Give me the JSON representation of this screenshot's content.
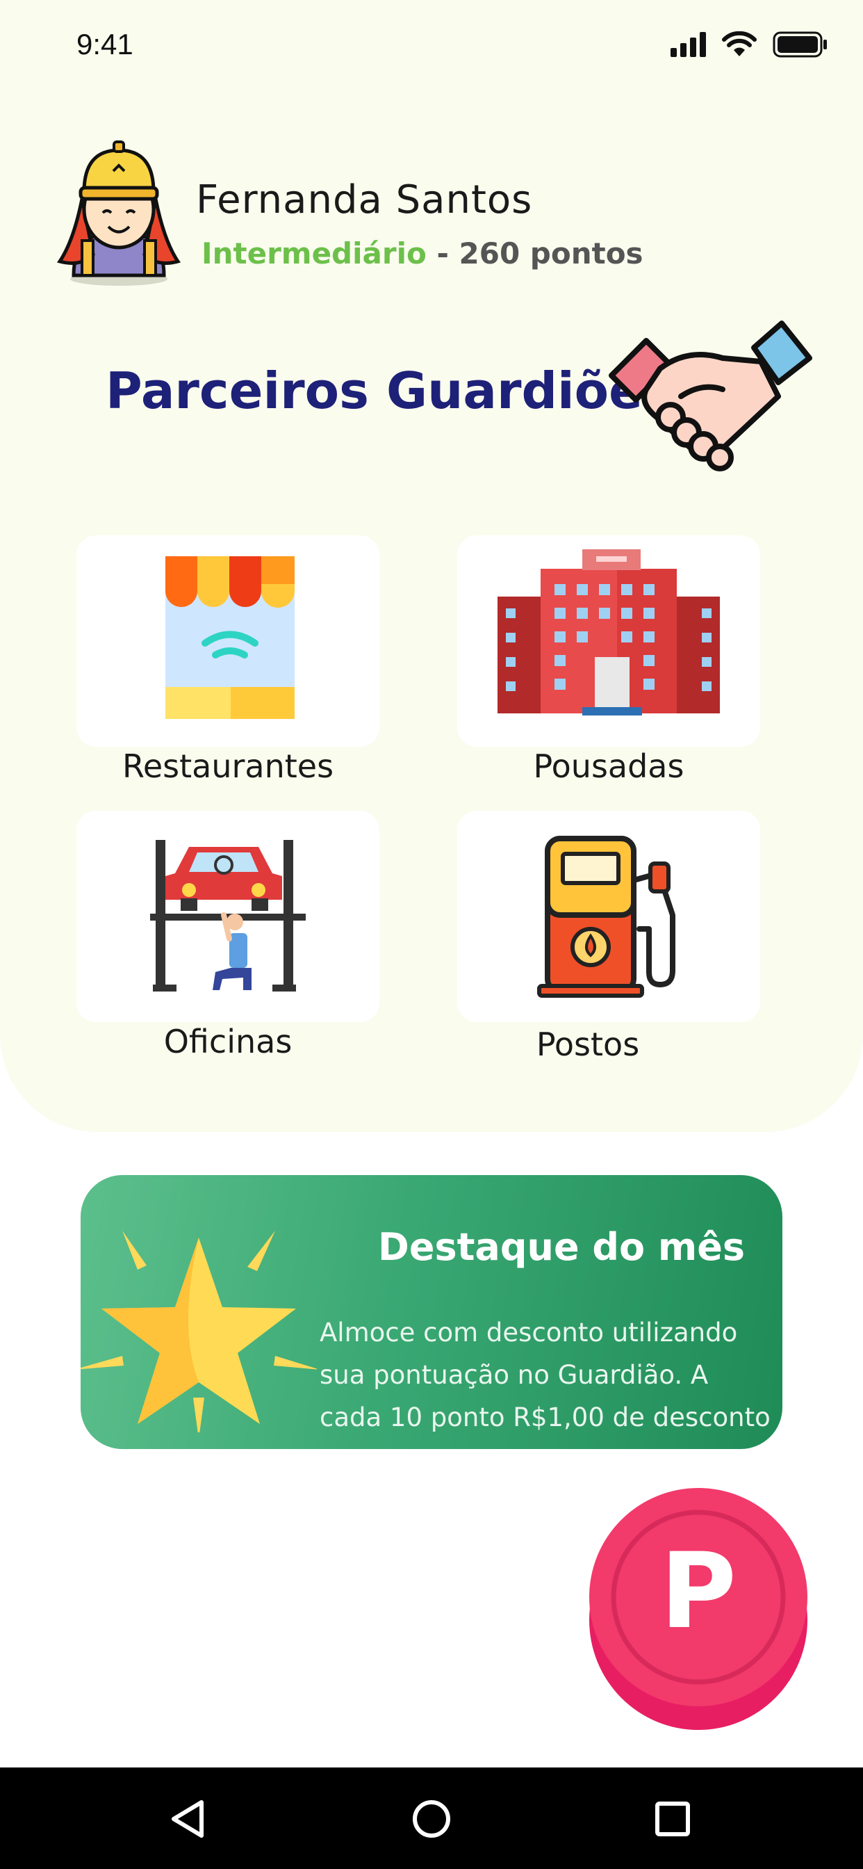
{
  "status_bar": {
    "time": "9:41",
    "icons": [
      "signal-icon",
      "wifi-icon",
      "battery-icon"
    ]
  },
  "profile": {
    "name": "Fernanda Santos",
    "level": "Intermediário",
    "points_text": " - 260 pontos",
    "avatar_icon": "avatar-explorer-icon"
  },
  "page": {
    "title": "Parceiros Guardiões",
    "title_icon": "handshake-icon"
  },
  "categories": [
    {
      "label": "Restaurantes",
      "icon": "store-wifi-icon"
    },
    {
      "label": "Pousadas",
      "icon": "hotel-building-icon"
    },
    {
      "label": "Oficinas",
      "icon": "car-lift-mechanic-icon"
    },
    {
      "label": "Postos",
      "icon": "fuel-pump-icon"
    }
  ],
  "highlight": {
    "title": "Destaque do mês",
    "lines": [
      "Almoce com desconto utilizando",
      "sua pontuação no Guardião. A",
      "cada 10 ponto R$1,00 de desconto"
    ],
    "icon": "star-icon"
  },
  "points_button": {
    "letter": "P"
  },
  "nav": {
    "buttons": [
      "back-icon",
      "home-icon",
      "recents-icon"
    ]
  },
  "colors": {
    "panel_bg": "#fafcee",
    "title_blue": "#1e2178",
    "level_green": "#6cc04a",
    "banner_green": "#3aa873",
    "coin_pink": "#f23a6b"
  }
}
